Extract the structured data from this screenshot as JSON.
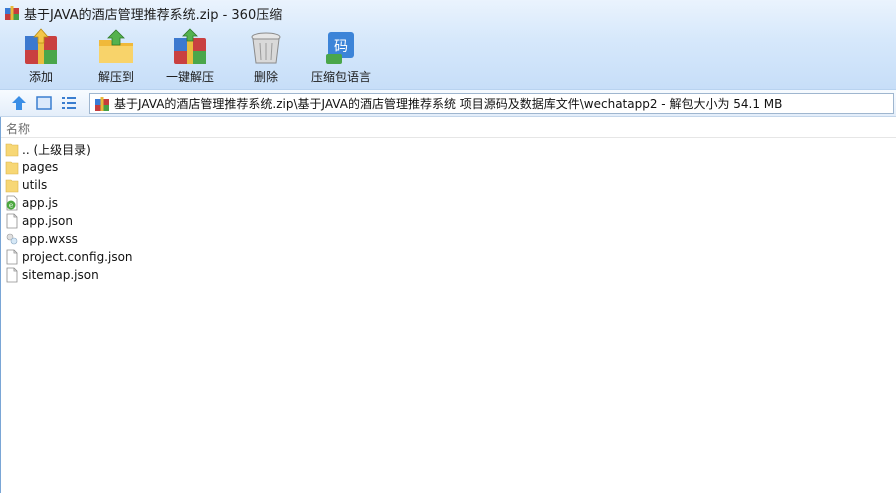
{
  "window": {
    "title": "基于JAVA的酒店管理推荐系统.zip - 360压缩"
  },
  "toolbar": {
    "add": "添加",
    "extract_to": "解压到",
    "one_click": "一键解压",
    "delete": "删除",
    "lang": "压缩包语言"
  },
  "address": {
    "path": "基于JAVA的酒店管理推荐系统.zip\\基于JAVA的酒店管理推荐系统 项目源码及数据库文件\\wechatapp2 - 解包大小为 54.1 MB"
  },
  "columns": {
    "name": "名称"
  },
  "files": [
    {
      "name": ".. (上级目录)",
      "icon": "folder-icon"
    },
    {
      "name": "pages",
      "icon": "folder-icon"
    },
    {
      "name": "utils",
      "icon": "folder-icon"
    },
    {
      "name": "app.js",
      "icon": "js-file-icon"
    },
    {
      "name": "app.json",
      "icon": "file-icon"
    },
    {
      "name": "app.wxss",
      "icon": "wxss-file-icon"
    },
    {
      "name": "project.config.json",
      "icon": "file-icon"
    },
    {
      "name": "sitemap.json",
      "icon": "file-icon"
    }
  ],
  "colors": {
    "toolbar_bg": "#d6e8fb",
    "folder": "#f7d775",
    "accent": "#3b7ed0"
  }
}
